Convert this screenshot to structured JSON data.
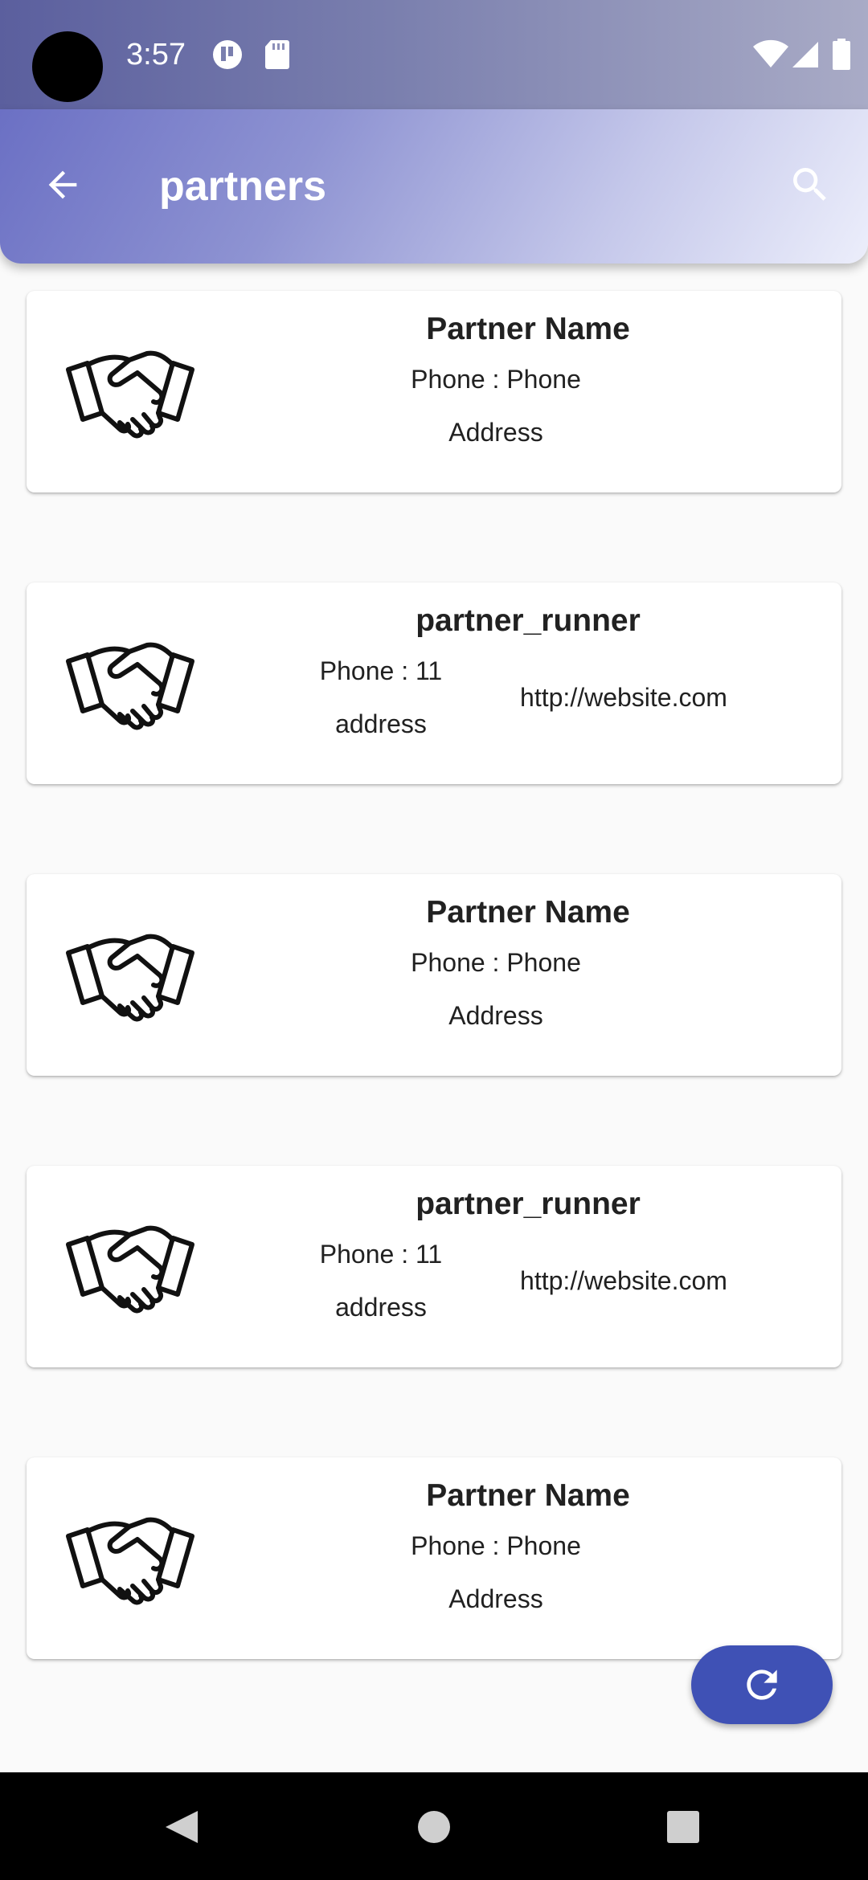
{
  "status_bar": {
    "time": "3:57",
    "left_icons": [
      "app-notification-icon",
      "sd-card-icon"
    ],
    "right_icons": [
      "wifi-icon",
      "cellular-signal-icon",
      "battery-icon"
    ]
  },
  "app_bar": {
    "title": "partners",
    "back_icon": "arrow-back-icon",
    "search_icon": "search-icon",
    "gradient": [
      "#6b70c4",
      "#eceefb"
    ]
  },
  "partners": [
    {
      "type": "simple",
      "icon": "handshake-icon",
      "name": "Partner Name",
      "phone": "Phone : Phone",
      "address": "Address"
    },
    {
      "type": "runner",
      "icon": "handshake-icon",
      "name": "partner_runner",
      "phone": "Phone : 11",
      "address": "address",
      "website": "http://website.com"
    },
    {
      "type": "simple",
      "icon": "handshake-icon",
      "name": "Partner Name",
      "phone": "Phone : Phone",
      "address": "Address"
    },
    {
      "type": "runner",
      "icon": "handshake-icon",
      "name": "partner_runner",
      "phone": "Phone : 11",
      "address": "address",
      "website": "http://website.com"
    },
    {
      "type": "simple",
      "icon": "handshake-icon",
      "name": "Partner Name",
      "phone": "Phone : Phone",
      "address": "Address"
    }
  ],
  "fab": {
    "icon": "refresh-icon",
    "color": "#3f51b5"
  },
  "nav_bar": {
    "buttons": [
      "back-triangle-icon",
      "home-circle-icon",
      "recents-square-icon"
    ]
  }
}
